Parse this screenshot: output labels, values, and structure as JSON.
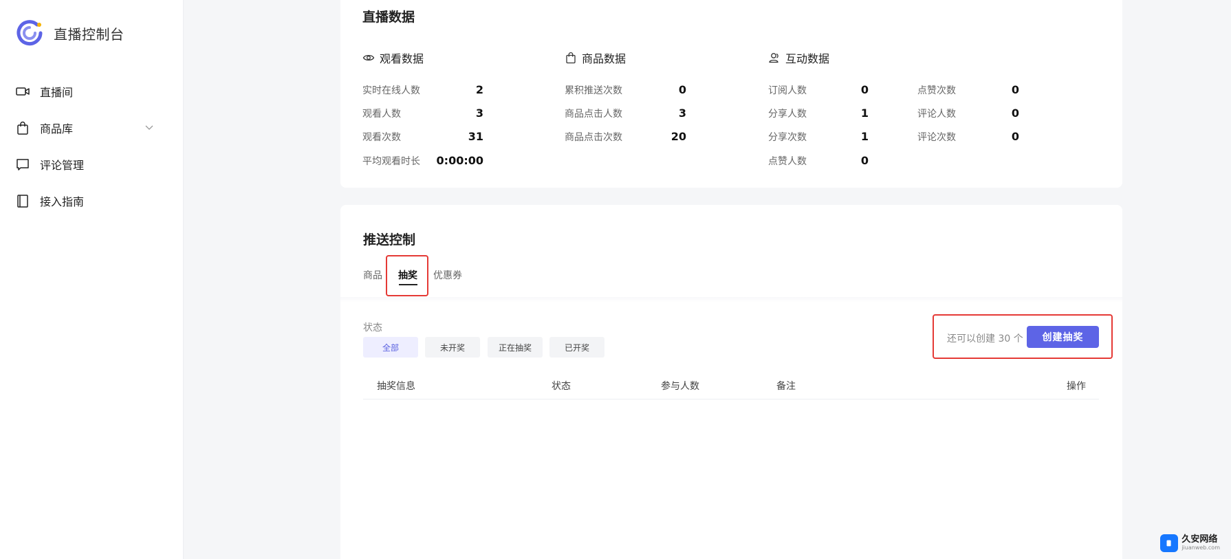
{
  "app": {
    "title": "直播控制台",
    "brand_color": "#5d64e6"
  },
  "sidebar": {
    "items": [
      {
        "label": "直播间",
        "icon": "video-camera-icon"
      },
      {
        "label": "商品库",
        "icon": "shopping-bag-icon",
        "expandable": true
      },
      {
        "label": "评论管理",
        "icon": "comment-icon"
      },
      {
        "label": "接入指南",
        "icon": "book-icon"
      }
    ]
  },
  "live_data": {
    "title": "直播数据",
    "watch": {
      "title": "观看数据",
      "icon": "eye-icon",
      "stats": [
        {
          "label": "实时在线人数",
          "value": "2"
        },
        {
          "label": "观看人数",
          "value": "3"
        },
        {
          "label": "观看次数",
          "value": "31"
        },
        {
          "label": "平均观看时长",
          "value": "0:00:00"
        }
      ]
    },
    "goods": {
      "title": "商品数据",
      "icon": "shopping-bag-icon",
      "stats": [
        {
          "label": "累积推送次数",
          "value": "0"
        },
        {
          "label": "商品点击人数",
          "value": "3"
        },
        {
          "label": "商品点击次数",
          "value": "20"
        }
      ]
    },
    "interaction": {
      "title": "互动数据",
      "icon": "users-icon",
      "stats_left": [
        {
          "label": "订阅人数",
          "value": "0"
        },
        {
          "label": "分享人数",
          "value": "1"
        },
        {
          "label": "分享次数",
          "value": "1"
        },
        {
          "label": "点赞人数",
          "value": "0"
        }
      ],
      "stats_right": [
        {
          "label": "点赞次数",
          "value": "0"
        },
        {
          "label": "评论人数",
          "value": "0"
        },
        {
          "label": "评论次数",
          "value": "0"
        }
      ]
    }
  },
  "push_control": {
    "title": "推送控制",
    "tabs": [
      {
        "label": "商品",
        "active": false
      },
      {
        "label": "抽奖",
        "active": true
      },
      {
        "label": "优惠券",
        "active": false
      }
    ],
    "filter": {
      "label": "状态",
      "options": [
        {
          "label": "全部",
          "active": true
        },
        {
          "label": "未开奖",
          "active": false
        },
        {
          "label": "正在抽奖",
          "active": false
        },
        {
          "label": "已开奖",
          "active": false
        }
      ]
    },
    "hint": "还可以创建 30 个",
    "create_button": "创建抽奖",
    "table": {
      "columns": [
        "抽奖信息",
        "状态",
        "参与人数",
        "备注",
        "操作"
      ]
    }
  },
  "watermark": {
    "main": "久安网络",
    "sub": "jiuanweb.com"
  }
}
